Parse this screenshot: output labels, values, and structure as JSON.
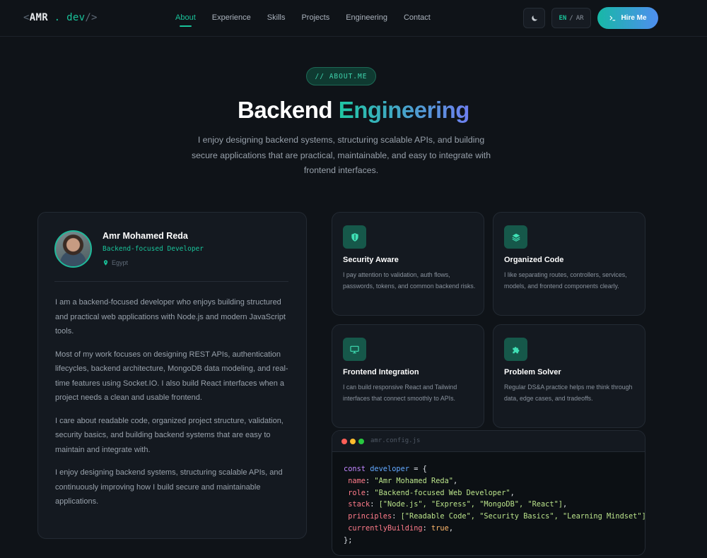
{
  "nav": {
    "logo": {
      "open": "<",
      "name": "AMR",
      "dot": ".",
      "tld": "dev",
      "close": "/>"
    },
    "links": [
      "About",
      "Experience",
      "Skills",
      "Projects",
      "Engineering",
      "Contact"
    ],
    "active_index": 0,
    "lang": {
      "en": "EN",
      "sep": "/",
      "ar": "AR"
    },
    "hire_label": "Hire Me"
  },
  "hero": {
    "badge": "// ABOUT.ME",
    "title_part1": "Backend",
    "title_part2": "Engineering",
    "subtitle": "I enjoy designing backend systems, structuring scalable APIs, and building secure applications that are practical, maintainable, and easy to integrate with frontend interfaces."
  },
  "profile": {
    "name": "Amr Mohamed Reda",
    "role": "Backend-focused Developer",
    "location": "Egypt",
    "paragraphs": [
      "I am a backend-focused developer who enjoys building structured and practical web applications with Node.js and modern JavaScript tools.",
      "Most of my work focuses on designing REST APIs, authentication lifecycles, backend architecture, MongoDB data modeling, and real-time features using Socket.IO. I also build React interfaces when a project needs a clean and usable frontend.",
      "I care about readable code, organized project structure, validation, security basics, and building backend systems that are easy to maintain and integrate with.",
      "I enjoy designing backend systems, structuring scalable APIs, and continuously improving how I build secure and maintainable applications."
    ]
  },
  "features": [
    {
      "title": "Security Aware",
      "desc": "I pay attention to validation, auth flows, passwords, tokens, and common backend risks.",
      "icon": "shield-icon"
    },
    {
      "title": "Organized Code",
      "desc": "I like separating routes, controllers, services, models, and frontend components clearly.",
      "icon": "layers-icon"
    },
    {
      "title": "Frontend Integration",
      "desc": "I can build responsive React and Tailwind interfaces that connect smoothly to APIs.",
      "icon": "monitor-icon"
    },
    {
      "title": "Problem Solver",
      "desc": "Regular DS&A practice helps me think through data, edge cases, and tradeoffs.",
      "icon": "puzzle-icon"
    }
  ],
  "code": {
    "filename": "amr.config.js",
    "const_kw": "const",
    "var_name": "developer",
    "open": " = {",
    "lines": [
      {
        "key": "name",
        "value": "\"Amr Mohamed Reda\"",
        "kind": "str"
      },
      {
        "key": "role",
        "value": "\"Backend-focused Web Developer\"",
        "kind": "str"
      },
      {
        "key": "stack",
        "value": "[\"Node.js\", \"Express\", \"MongoDB\", \"React\"]",
        "kind": "arr"
      },
      {
        "key": "principles",
        "value": "[\"Readable Code\", \"Security Basics\", \"Learning Mindset\"]",
        "kind": "arr"
      },
      {
        "key": "currentlyBuilding",
        "value": "true",
        "kind": "bool"
      }
    ],
    "close": "};"
  },
  "colors": {
    "accent": "#19c39a",
    "background": "#0f1318",
    "card": "#141920",
    "dot_red": "#ff5f57",
    "dot_yellow": "#febc2e",
    "dot_green": "#28c840"
  }
}
